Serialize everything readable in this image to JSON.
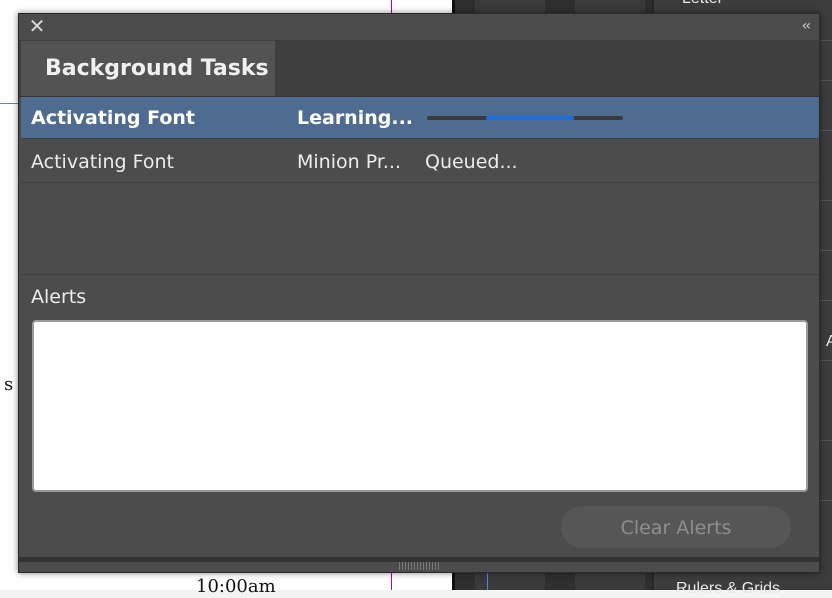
{
  "background": {
    "doc_text_left": "s",
    "doc_text_bottom": "10:00am",
    "right_panel_top": "Letter",
    "right_panel_bottom": "Rulers & Grids",
    "right_panel_mid": "A"
  },
  "panel": {
    "title_tab": "Background Tasks",
    "tasks": [
      {
        "name": "Activating Font",
        "detail": "Learning...",
        "status": "",
        "progress": 0.45,
        "selected": true
      },
      {
        "name": "Activating Font",
        "detail": "Minion Pr...",
        "status": "Queued...",
        "selected": false
      }
    ],
    "alerts_label": "Alerts",
    "alerts_text": "",
    "clear_button_label": "Clear Alerts"
  },
  "icons": {
    "close": "close-icon",
    "collapse": "collapse-icon",
    "resize": "resize-grip-icon"
  },
  "colors": {
    "selection": "#4d6c8f",
    "progress": "#1f6ee0",
    "panel": "#4c4c4c"
  }
}
